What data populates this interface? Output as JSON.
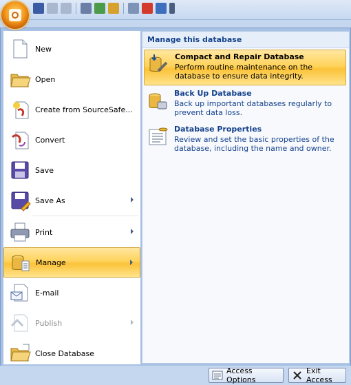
{
  "right_pane": {
    "title": "Manage this database",
    "items": [
      {
        "title": "Compact and Repair Database",
        "desc": "Perform routine maintenance on the database to ensure data integrity."
      },
      {
        "title": "Back Up Database",
        "desc": "Back up important databases regularly to prevent data loss."
      },
      {
        "title": "Database Properties",
        "desc": "Review and set the basic properties of the database, including the name and owner."
      }
    ]
  },
  "menu": {
    "items": [
      {
        "label": "New",
        "icon": "new-document-icon"
      },
      {
        "label": "Open",
        "icon": "open-folder-icon"
      },
      {
        "label": "Create from SourceSafe...",
        "icon": "sourcesafe-icon"
      },
      {
        "label": "Convert",
        "icon": "convert-icon"
      },
      {
        "label": "Save",
        "icon": "save-icon"
      },
      {
        "label": "Save As",
        "icon": "save-as-icon"
      },
      {
        "label": "Print",
        "icon": "printer-icon"
      },
      {
        "label": "Manage",
        "icon": "manage-icon"
      },
      {
        "label": "E-mail",
        "icon": "email-icon"
      },
      {
        "label": "Publish",
        "icon": "publish-icon"
      },
      {
        "label": "Close Database",
        "icon": "close-database-icon"
      }
    ]
  },
  "bottom": {
    "access_options": "Access Options",
    "exit_access": "Exit Access"
  },
  "colors": {
    "highlight": "#ffd35c",
    "heading": "#15428b",
    "frame": "#a7c1e4"
  }
}
